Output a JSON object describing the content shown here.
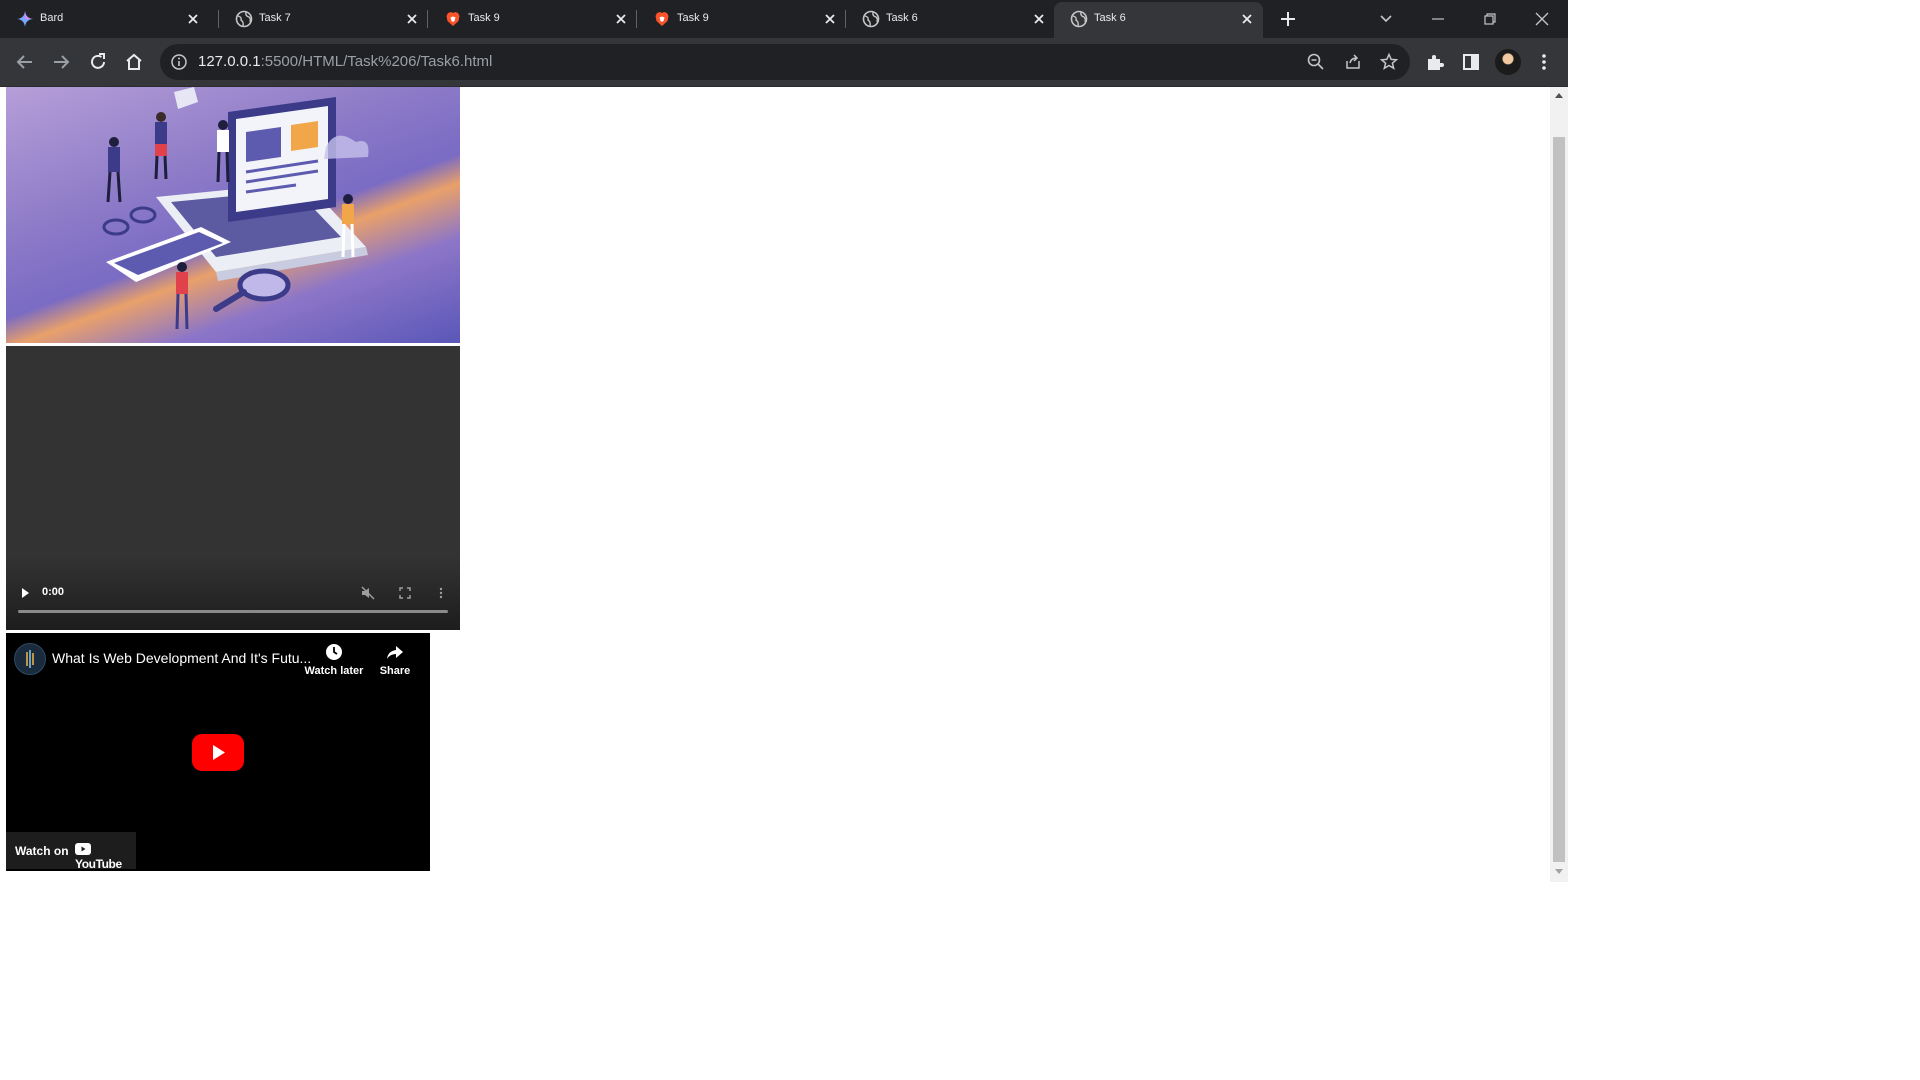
{
  "tabs": [
    {
      "title": "Bard",
      "icon": "bard-icon",
      "active": false
    },
    {
      "title": "Task 7",
      "icon": "globe-icon",
      "active": false
    },
    {
      "title": "Task 9",
      "icon": "brave-icon",
      "active": false
    },
    {
      "title": "Task 9",
      "icon": "brave-icon",
      "active": false
    },
    {
      "title": "Task 6",
      "icon": "globe-icon",
      "active": false
    },
    {
      "title": "Task 6",
      "icon": "globe-icon",
      "active": true
    }
  ],
  "address_bar": {
    "url_host": "127.0.0.1",
    "url_rest": ":5500/HTML/Task%206/Task6.html"
  },
  "video_player": {
    "time": "0:00"
  },
  "youtube_embed": {
    "title": "What Is Web Development And It's Futu...",
    "watch_later": "Watch later",
    "share": "Share",
    "watch_on": "Watch on",
    "brand": "YouTube"
  },
  "colors": {
    "tabstrip": "#202124",
    "toolbar": "#35363a",
    "youtube_red": "#ff0000"
  }
}
